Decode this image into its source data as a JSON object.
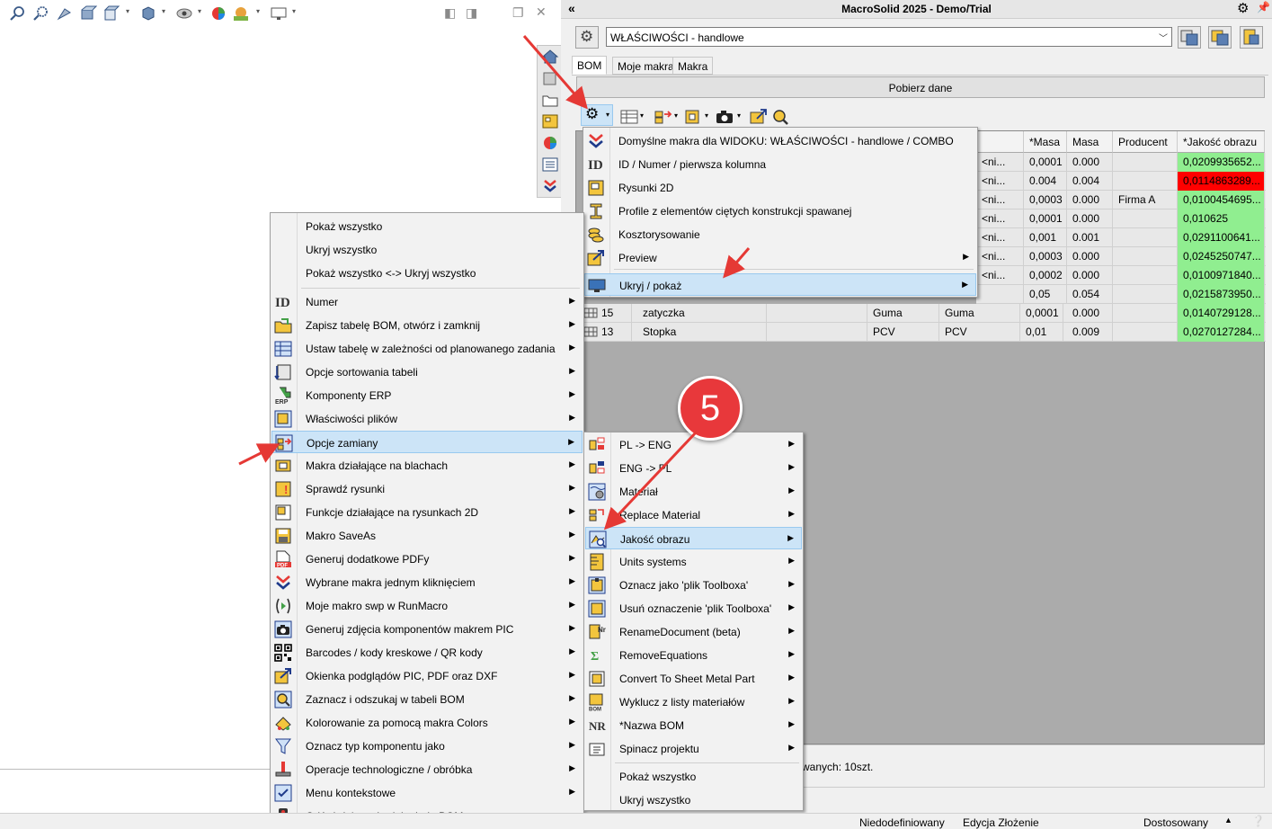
{
  "app": {
    "title": "MacroSolid 2025 - Demo/Trial"
  },
  "config_select": {
    "value": "WŁAŚCIWOŚCI - handlowe"
  },
  "tabs": [
    {
      "label": "BOM"
    },
    {
      "label": "Moje makra"
    },
    {
      "label": "Makra"
    }
  ],
  "fetch_button": {
    "label": "Pobierz dane"
  },
  "grid": {
    "headers": [
      "*Masa",
      "Masa",
      "Producent",
      "*Jakość obrazu"
    ],
    "rows": [
      {
        "c1": "<ni...",
        "masa_star": "0,0001",
        "masa": "0.000",
        "producent": "",
        "jakosc": "0,0209935652...",
        "status": "ok"
      },
      {
        "c1": "<ni...",
        "masa_star": "0.004",
        "masa": "0.004",
        "producent": "",
        "jakosc": "0,0114863289...",
        "status": "bad"
      },
      {
        "c1": "<ni...",
        "masa_star": "0,0003",
        "masa": "0.000",
        "producent": "Firma A",
        "jakosc": "0,0100454695...",
        "status": "ok"
      },
      {
        "c1": "<ni...",
        "masa_star": "0,0001",
        "masa": "0.000",
        "producent": "",
        "jakosc": "0,010625",
        "status": "ok"
      },
      {
        "c1": "<ni...",
        "masa_star": "0,001",
        "masa": "0.001",
        "producent": "",
        "jakosc": "0,0291100641...",
        "status": "ok"
      },
      {
        "c1": "<ni...",
        "masa_star": "0,0003",
        "masa": "0.000",
        "producent": "",
        "jakosc": "0,0245250747...",
        "status": "ok"
      },
      {
        "c1": "<ni...",
        "masa_star": "0,0002",
        "masa": "0.000",
        "producent": "",
        "jakosc": "0,0100971840...",
        "status": "ok"
      },
      {
        "c1": "",
        "masa_star": "0,05",
        "masa": "0.054",
        "producent": "",
        "jakosc": "0,0215873950...",
        "status": "ok"
      }
    ],
    "rows_named": [
      {
        "num": "15",
        "name": "zatyczka",
        "mat": "Guma",
        "mat2": "Guma",
        "masa_star": "0,0001",
        "masa": "0.000",
        "jakosc": "0,0140729128..."
      },
      {
        "num": "13",
        "name": "Stopka",
        "mat": "PCV",
        "mat2": "PCV",
        "masa_star": "0,01",
        "masa": "0.009",
        "jakosc": "0,0270127284..."
      }
    ]
  },
  "status_text": "wanych: 10szt.",
  "bottom": {
    "status1": "Niedodefiniowany",
    "status2": "Edycja Złożenie",
    "status3": "Dostosowany"
  },
  "menu_top": {
    "items": [
      {
        "label": "Domyślne makra dla WIDOKU: WŁAŚCIWOŚCI - handlowe / COMBO",
        "icon": "macro-down-icon"
      },
      {
        "label": "ID / Numer / pierwsza kolumna",
        "icon": "id-icon"
      },
      {
        "label": "Rysunki 2D",
        "icon": "drawing-icon"
      },
      {
        "label": "Profile z elementów ciętych konstrukcji spawanej",
        "icon": "profile-icon"
      },
      {
        "label": "Kosztorysowanie",
        "icon": "cost-icon"
      },
      {
        "label": "Preview",
        "icon": "preview-icon",
        "sub": true
      },
      {
        "label": "Ukryj / pokaż",
        "icon": "monitor-icon",
        "sub": true,
        "hl": true
      }
    ]
  },
  "menu_left": {
    "top_items": [
      {
        "label": "Pokaż wszystko"
      },
      {
        "label": "Ukryj wszystko"
      },
      {
        "label": "Pokaż wszystko <-> Ukryj wszystko"
      }
    ],
    "items": [
      {
        "label": "Numer",
        "icon": "id-icon"
      },
      {
        "label": "Zapisz tabelę BOM, otwórz i zamknij",
        "icon": "folder-icon"
      },
      {
        "label": "Ustaw tabelę w zależności od planowanego zadania",
        "icon": "table-icon"
      },
      {
        "label": "Opcje sortowania tabeli",
        "icon": "sort-icon"
      },
      {
        "label": "Komponenty ERP",
        "icon": "erp-icon"
      },
      {
        "label": "Właściwości plików",
        "icon": "file-props-icon"
      },
      {
        "label": "Opcje zamiany",
        "icon": "replace-icon",
        "hl": true
      },
      {
        "label": "Makra działające na blachach",
        "icon": "sheet-icon"
      },
      {
        "label": "Sprawdź rysunki",
        "icon": "check-drawing-icon"
      },
      {
        "label": "Funkcje działające na rysunkach 2D",
        "icon": "drawing-func-icon"
      },
      {
        "label": "Makro SaveAs",
        "icon": "saveas-icon"
      },
      {
        "label": "Generuj dodatkowe PDFy",
        "icon": "pdf-icon"
      },
      {
        "label": "Wybrane makra jednym kliknięciem",
        "icon": "macro-down-icon"
      },
      {
        "label": "Moje makro swp w RunMacro",
        "icon": "runmacro-icon"
      },
      {
        "label": "Generuj zdjęcia komponentów makrem PIC",
        "icon": "camera-icon"
      },
      {
        "label": "Barcodes / kody kreskowe / QR kody",
        "icon": "qr-icon"
      },
      {
        "label": "Okienka podglądów PIC, PDF oraz DXF",
        "icon": "preview-icon"
      },
      {
        "label": "Zaznacz i odszukaj w tabeli BOM",
        "icon": "search-icon"
      },
      {
        "label": "Kolorowanie za pomocą makra Colors",
        "icon": "colors-icon"
      },
      {
        "label": "Oznacz typ komponentu jako",
        "icon": "filter-icon"
      },
      {
        "label": "Operacje technologiczne / obróbka",
        "icon": "tech-icon"
      },
      {
        "label": "Menu kontekstowe",
        "icon": "check-icon"
      },
      {
        "label": "Odśwież / przebuduj tabelę BOM",
        "icon": "traffic-light-icon",
        "nosub": true
      }
    ]
  },
  "menu_sub": {
    "items": [
      {
        "label": "PL -> ENG",
        "icon": "translate-icon"
      },
      {
        "label": "ENG -> PL",
        "icon": "translate2-icon"
      },
      {
        "label": "Materiał",
        "icon": "material-icon"
      },
      {
        "label": "Replace Material",
        "icon": "replace-material-icon"
      },
      {
        "label": "Jakość obrazu",
        "icon": "image-quality-icon",
        "hl": true
      },
      {
        "label": "Units systems",
        "icon": "units-icon"
      },
      {
        "label": "Oznacz jako 'plik Toolboxa'",
        "icon": "toolbox-icon"
      },
      {
        "label": "Usuń oznaczenie 'plik Toolboxa'",
        "icon": "toolbox-remove-icon"
      },
      {
        "label": "RenameDocument (beta)",
        "icon": "rename-icon"
      },
      {
        "label": "RemoveEquations",
        "icon": "equation-icon"
      },
      {
        "label": "Convert To Sheet Metal Part",
        "icon": "sheetmetal-icon"
      },
      {
        "label": "Wyklucz z listy materiałów",
        "icon": "exclude-icon"
      },
      {
        "label": "*Nazwa BOM",
        "icon": "nr-icon"
      },
      {
        "label": "Spinacz projektu",
        "icon": "clip-icon"
      }
    ],
    "bottom_items": [
      {
        "label": "Pokaż wszystko"
      },
      {
        "label": "Ukryj wszystko"
      }
    ]
  },
  "badge": {
    "number": "5"
  },
  "colors": {
    "accent_hl": "#cce4f7",
    "ok_cell": "#90ee90",
    "bad_cell": "#ff0000",
    "badge": "#e8383b"
  }
}
